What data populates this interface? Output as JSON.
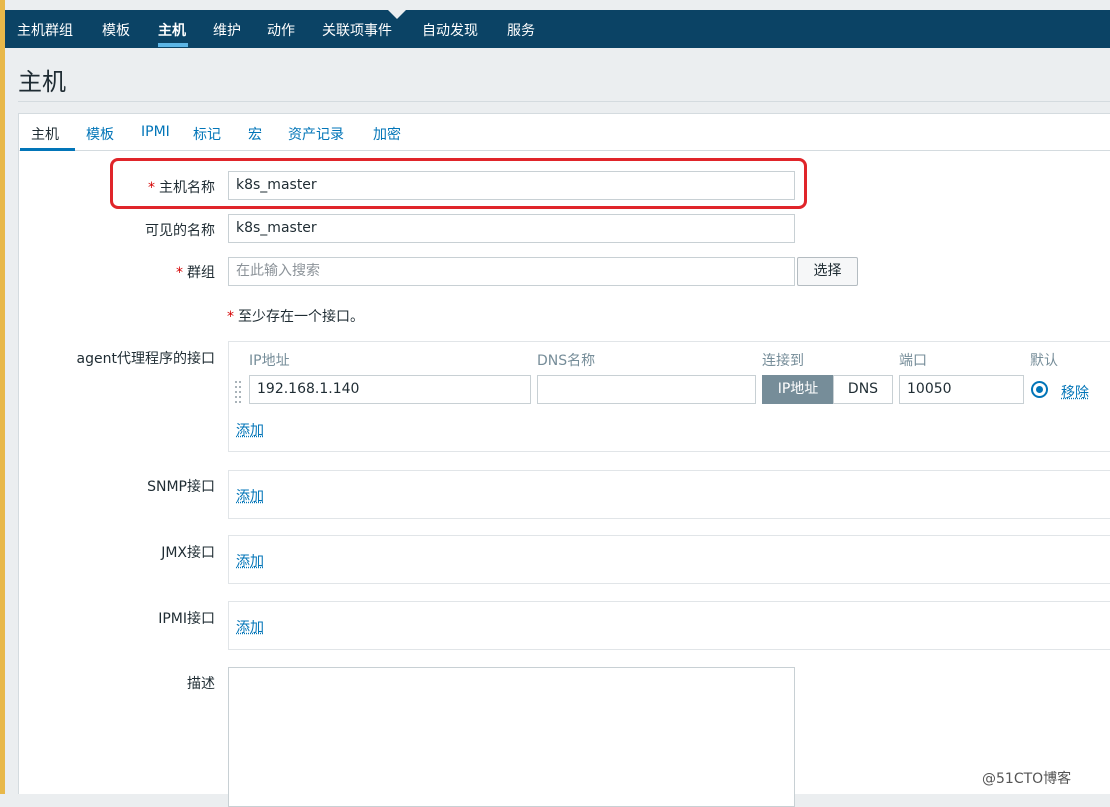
{
  "nav": {
    "items": [
      "主机群组",
      "模板",
      "主机",
      "维护",
      "动作",
      "关联项事件",
      "自动发现",
      "服务"
    ],
    "active": "主机"
  },
  "page": {
    "title": "主机"
  },
  "tabs": {
    "items": [
      "主机",
      "模板",
      "IPMI",
      "标记",
      "宏",
      "资产记录",
      "加密"
    ],
    "active": "主机"
  },
  "form": {
    "host_name_label": "主机名称",
    "host_name_value": "k8s_master",
    "visible_name_label": "可见的名称",
    "visible_name_value": "k8s_master",
    "groups_label": "群组",
    "groups_placeholder": "在此输入搜索",
    "select_button": "选择",
    "required_mark": "*",
    "interface_note": "至少存在一个接口。",
    "agent_label": "agent代理程序的接口",
    "agent_columns": [
      "IP地址",
      "DNS名称",
      "连接到",
      "端口",
      "默认"
    ],
    "agent_row": {
      "ip": "192.168.1.140",
      "dns": "",
      "connect_ip": "IP地址",
      "connect_dns": "DNS",
      "port": "10050",
      "remove": "移除"
    },
    "add_label": "添加",
    "snmp_label": "SNMP接口",
    "jmx_label": "JMX接口",
    "ipmi_label": "IPMI接口",
    "description_label": "描述"
  },
  "watermark": "@51CTO博客",
  "colors": {
    "nav_bg": "#0b4365",
    "link": "#0275b8",
    "highlight": "#e0252a",
    "required": "#d40000"
  }
}
